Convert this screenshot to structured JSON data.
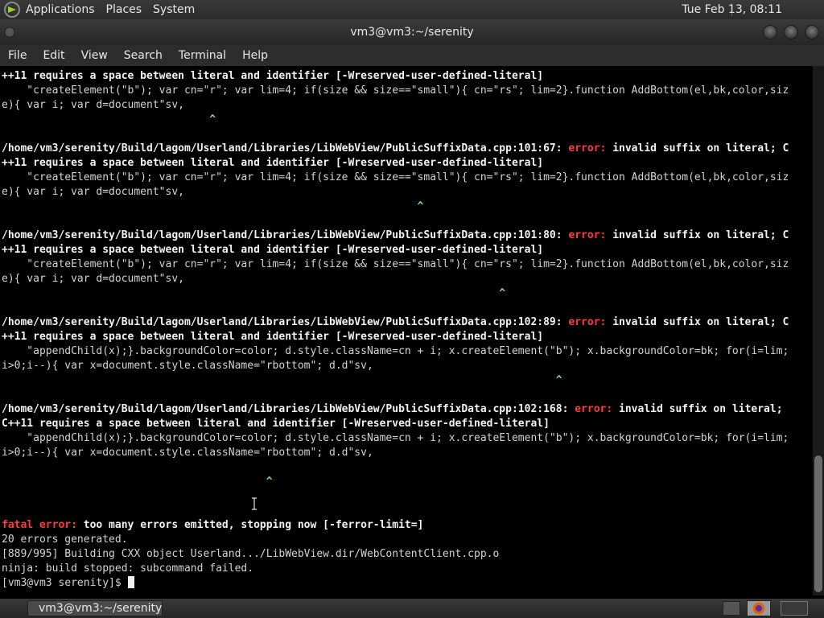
{
  "top_panel": {
    "menus": [
      "Applications",
      "Places",
      "System"
    ],
    "clock": "Tue Feb 13, 08:11"
  },
  "window": {
    "title": "vm3@vm3:~/serenity"
  },
  "menubar": [
    "File",
    "Edit",
    "View",
    "Search",
    "Terminal",
    "Help"
  ],
  "terminal": {
    "lines": [
      {
        "kind": "bold",
        "text": "++11 requires a space between literal and identifier [-Wreserved-user-defined-literal]"
      },
      {
        "kind": "plain",
        "text": "    \"createElement(\"b\"); var cn=\"r\"; var lim=4; if(size && size==\"small\"){ cn=\"rs\"; lim=2}.function AddBottom(el,bk,color,siz"
      },
      {
        "kind": "plain",
        "text": "e){ var i; var d=document\"sv,"
      },
      {
        "kind": "caret",
        "text": "                                 ^"
      },
      {
        "kind": "blank",
        "text": ""
      },
      {
        "kind": "error",
        "prefix": "/home/vm3/serenity/Build/lagom/Userland/Libraries/LibWebView/PublicSuffixData.cpp:101:67: ",
        "label": "error:",
        "suffix": " invalid suffix on literal; C"
      },
      {
        "kind": "bold",
        "text": "++11 requires a space between literal and identifier [-Wreserved-user-defined-literal]"
      },
      {
        "kind": "plain",
        "text": "    \"createElement(\"b\"); var cn=\"r\"; var lim=4; if(size && size==\"small\"){ cn=\"rs\"; lim=2}.function AddBottom(el,bk,color,siz"
      },
      {
        "kind": "plain",
        "text": "e){ var i; var d=document\"sv,"
      },
      {
        "kind": "caret",
        "text": "                                                                  ^"
      },
      {
        "kind": "blank",
        "text": ""
      },
      {
        "kind": "error",
        "prefix": "/home/vm3/serenity/Build/lagom/Userland/Libraries/LibWebView/PublicSuffixData.cpp:101:80: ",
        "label": "error:",
        "suffix": " invalid suffix on literal; C"
      },
      {
        "kind": "bold",
        "text": "++11 requires a space between literal and identifier [-Wreserved-user-defined-literal]"
      },
      {
        "kind": "plain",
        "text": "    \"createElement(\"b\"); var cn=\"r\"; var lim=4; if(size && size==\"small\"){ cn=\"rs\"; lim=2}.function AddBottom(el,bk,color,siz"
      },
      {
        "kind": "plain",
        "text": "e){ var i; var d=document\"sv,"
      },
      {
        "kind": "caret",
        "text": "                                                                               ^"
      },
      {
        "kind": "blank",
        "text": ""
      },
      {
        "kind": "error",
        "prefix": "/home/vm3/serenity/Build/lagom/Userland/Libraries/LibWebView/PublicSuffixData.cpp:102:89: ",
        "label": "error:",
        "suffix": " invalid suffix on literal; C"
      },
      {
        "kind": "bold",
        "text": "++11 requires a space between literal and identifier [-Wreserved-user-defined-literal]"
      },
      {
        "kind": "plain",
        "text": "    \"appendChild(x);}.backgroundColor=color; d.style.className=cn + i; x.createElement(\"b\"); x.backgroundColor=bk; for(i=lim;"
      },
      {
        "kind": "plain",
        "text": "i>0;i--){ var x=document.style.className=\"rbottom\"; d.d\"sv,"
      },
      {
        "kind": "caret",
        "text": "                                                                                        ^"
      },
      {
        "kind": "blank",
        "text": ""
      },
      {
        "kind": "error",
        "prefix": "/home/vm3/serenity/Build/lagom/Userland/Libraries/LibWebView/PublicSuffixData.cpp:102:168: ",
        "label": "error:",
        "suffix": " invalid suffix on literal;"
      },
      {
        "kind": "bold",
        "text": "C++11 requires a space between literal and identifier [-Wreserved-user-defined-literal]"
      },
      {
        "kind": "plain",
        "text": "    \"appendChild(x);}.backgroundColor=color; d.style.className=cn + i; x.createElement(\"b\"); x.backgroundColor=bk; for(i=lim;"
      },
      {
        "kind": "plain",
        "text": "i>0;i--){ var x=document.style.className=\"rbottom\"; d.d\"sv,"
      },
      {
        "kind": "blank",
        "text": ""
      },
      {
        "kind": "caret",
        "text": "                                          ^"
      },
      {
        "kind": "blank",
        "text": ""
      },
      {
        "kind": "blank",
        "text": ""
      },
      {
        "kind": "fatal",
        "label": "fatal error:",
        "suffix": " too many errors emitted, stopping now [-ferror-limit=]"
      },
      {
        "kind": "plain",
        "text": "20 errors generated."
      },
      {
        "kind": "plain",
        "text": "[889/995] Building CXX object Userland.../LibWebView.dir/WebContentClient.cpp.o"
      },
      {
        "kind": "plain",
        "text": "ninja: build stopped: subcommand failed."
      },
      {
        "kind": "prompt",
        "text": "[vm3@vm3 serenity]$ "
      }
    ]
  },
  "taskbar": {
    "window_button": "vm3@vm3:~/serenity"
  },
  "colors": {
    "error": "#ff3b3b",
    "caret": "#7fe27f",
    "terminal_bg": "#000000"
  }
}
